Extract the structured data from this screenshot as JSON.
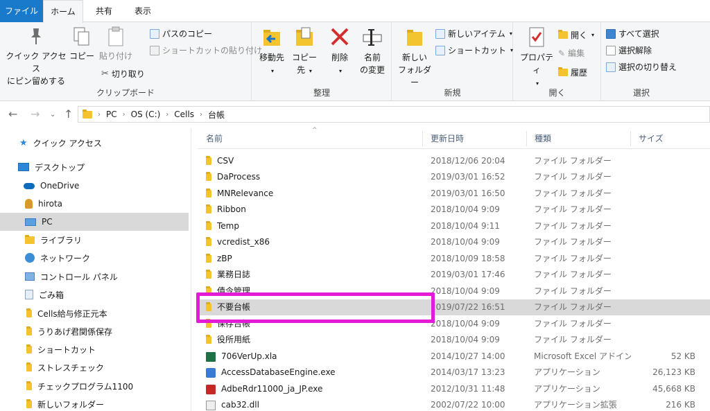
{
  "tabs": [
    {
      "label": "ファイル"
    },
    {
      "label": "ホーム"
    },
    {
      "label": "共有"
    },
    {
      "label": "表示"
    }
  ],
  "ribbon": {
    "clipboard": {
      "pin_line1": "クイック アクセス",
      "pin_line2": "にピン留めする",
      "copy": "コピー",
      "paste": "貼り付け",
      "copy_path": "パスのコピー",
      "paste_shortcut": "ショートカットの貼り付け",
      "cut": "切り取り",
      "label": "クリップボード"
    },
    "organize": {
      "move_to": "移動先",
      "copy_to": "コピー先",
      "delete": "削除",
      "rename_line1": "名前",
      "rename_line2": "の変更",
      "label": "整理"
    },
    "new": {
      "new_folder_line1": "新しい",
      "new_folder_line2": "フォルダー",
      "new_item": "新しいアイテム",
      "shortcut": "ショートカット",
      "label": "新規"
    },
    "open": {
      "properties": "プロパティ",
      "open": "開く",
      "edit": "編集",
      "history": "履歴",
      "label": "開く"
    },
    "select": {
      "select_all": "すべて選択",
      "deselect": "選択解除",
      "invert": "選択の切り替え",
      "label": "選択"
    }
  },
  "address": {
    "crumbs": [
      "PC",
      "OS (C:)",
      "Cells",
      "台帳"
    ]
  },
  "sidebar": {
    "items": [
      {
        "label": "クイック アクセス",
        "icon": "star-icon"
      },
      {
        "label": "デスクトップ",
        "icon": "desktop-icon"
      },
      {
        "label": "OneDrive",
        "icon": "cloud-icon"
      },
      {
        "label": "hirota",
        "icon": "user-icon"
      },
      {
        "label": "PC",
        "icon": "computer-icon"
      },
      {
        "label": "ライブラリ",
        "icon": "library-icon"
      },
      {
        "label": "ネットワーク",
        "icon": "network-icon"
      },
      {
        "label": "コントロール パネル",
        "icon": "control-panel-icon"
      },
      {
        "label": "ごみ箱",
        "icon": "recycle-bin-icon"
      },
      {
        "label": "Cells給与修正元本",
        "icon": "folder-icon"
      },
      {
        "label": "うりあげ君関係保存",
        "icon": "folder-icon"
      },
      {
        "label": "ショートカット",
        "icon": "folder-icon"
      },
      {
        "label": "ストレスチェック",
        "icon": "folder-icon"
      },
      {
        "label": "チェックプログラム1100",
        "icon": "folder-icon"
      },
      {
        "label": "新しいフォルダー",
        "icon": "folder-icon"
      }
    ]
  },
  "columns": {
    "name": "名前",
    "date": "更新日時",
    "type": "種類",
    "size": "サイズ"
  },
  "files": [
    {
      "name": "CSV",
      "date": "2018/12/06 20:04",
      "type": "ファイル フォルダー",
      "size": "",
      "icon": "folder"
    },
    {
      "name": "DaProcess",
      "date": "2019/03/01 16:52",
      "type": "ファイル フォルダー",
      "size": "",
      "icon": "folder"
    },
    {
      "name": "MNRelevance",
      "date": "2019/03/01 16:50",
      "type": "ファイル フォルダー",
      "size": "",
      "icon": "folder"
    },
    {
      "name": "Ribbon",
      "date": "2018/10/04 9:09",
      "type": "ファイル フォルダー",
      "size": "",
      "icon": "folder"
    },
    {
      "name": "Temp",
      "date": "2018/10/04 9:11",
      "type": "ファイル フォルダー",
      "size": "",
      "icon": "folder"
    },
    {
      "name": "vcredist_x86",
      "date": "2018/10/04 9:09",
      "type": "ファイル フォルダー",
      "size": "",
      "icon": "folder"
    },
    {
      "name": "zBP",
      "date": "2018/10/09 18:58",
      "type": "ファイル フォルダー",
      "size": "",
      "icon": "folder"
    },
    {
      "name": "業務日誌",
      "date": "2019/03/01 17:46",
      "type": "ファイル フォルダー",
      "size": "",
      "icon": "folder"
    },
    {
      "name": "債令管理",
      "date": "2018/10/04 9:09",
      "type": "ファイル フォルダー",
      "size": "",
      "icon": "folder"
    },
    {
      "name": "不要台帳",
      "date": "2019/07/22 16:51",
      "type": "ファイル フォルダー",
      "size": "",
      "icon": "folder",
      "selected": true
    },
    {
      "name": "保存台帳",
      "date": "2018/10/04 9:09",
      "type": "ファイル フォルダー",
      "size": "",
      "icon": "folder"
    },
    {
      "name": "役所用紙",
      "date": "2018/10/04 9:09",
      "type": "ファイル フォルダー",
      "size": "",
      "icon": "folder"
    },
    {
      "name": "706VerUp.xla",
      "date": "2014/10/27 14:00",
      "type": "Microsoft Excel アドイン",
      "size": "52 KB",
      "icon": "xla"
    },
    {
      "name": "AccessDatabaseEngine.exe",
      "date": "2014/03/17 13:23",
      "type": "アプリケーション",
      "size": "26,123 KB",
      "icon": "exe"
    },
    {
      "name": "AdbeRdr11000_ja_JP.exe",
      "date": "2012/10/31 11:48",
      "type": "アプリケーション",
      "size": "45,668 KB",
      "icon": "exe2"
    },
    {
      "name": "cab32.dll",
      "date": "2002/07/22 10:00",
      "type": "アプリケーション拡張",
      "size": "216 KB",
      "icon": "dll"
    }
  ],
  "colors": {
    "file_tab": "#1979ca",
    "highlight": "#e11bd6",
    "selected_row": "#d9d9d9"
  }
}
